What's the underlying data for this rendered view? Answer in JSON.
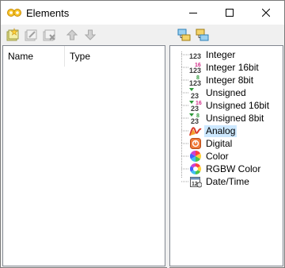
{
  "window": {
    "title": "Elements",
    "controls": [
      "minimize-icon",
      "maximize-icon",
      "close-icon"
    ]
  },
  "left_toolbar": [
    "add-element-icon",
    "edit-element-icon",
    "delete-element-icon",
    "move-up-icon",
    "move-down-icon"
  ],
  "right_toolbar": [
    "expand-all-icon",
    "collapse-all-icon"
  ],
  "list": {
    "columns": [
      "Name",
      "Type"
    ],
    "rows": []
  },
  "tree": {
    "selected": "Analog",
    "items": [
      {
        "label": "Integer",
        "icon": "integer-icon"
      },
      {
        "label": "Integer 16bit",
        "icon": "integer-16bit-icon"
      },
      {
        "label": "Integer 8bit",
        "icon": "integer-8bit-icon"
      },
      {
        "label": "Unsigned",
        "icon": "unsigned-icon"
      },
      {
        "label": "Unsigned 16bit",
        "icon": "unsigned-16bit-icon"
      },
      {
        "label": "Unsigned 8bit",
        "icon": "unsigned-8bit-icon"
      },
      {
        "label": "Analog",
        "icon": "analog-icon"
      },
      {
        "label": "Digital",
        "icon": "digital-icon"
      },
      {
        "label": "Color",
        "icon": "color-icon"
      },
      {
        "label": "RGBW Color",
        "icon": "rgbw-color-icon"
      },
      {
        "label": "Date/Time",
        "icon": "date-time-icon"
      }
    ]
  }
}
